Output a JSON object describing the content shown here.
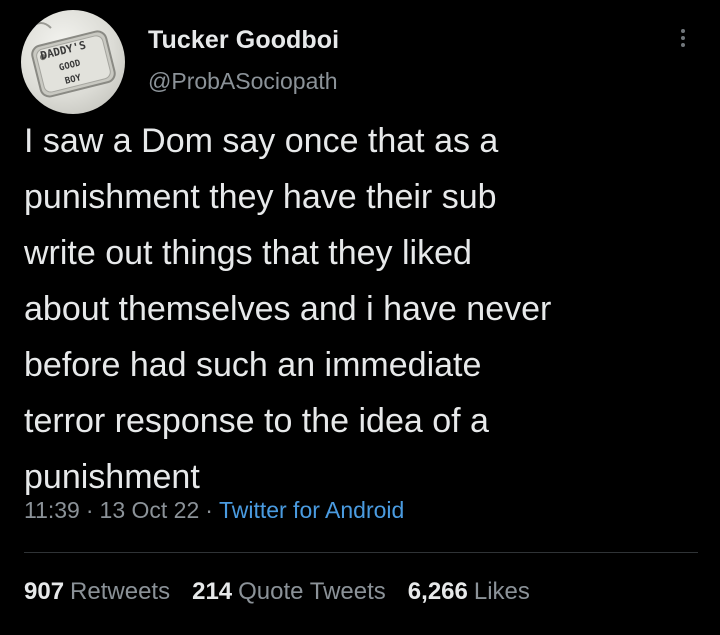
{
  "tweet": {
    "avatar": {
      "icon": "dog-tag-avatar",
      "tag_lines": [
        "DADDY'S",
        "GOOD",
        "BOY"
      ]
    },
    "display_name": "Tucker Goodboi",
    "handle": "@ProbASociopath",
    "more_icon": "more-options-icon",
    "body_lines": [
      "I saw a Dom say once that as a",
      "punishment they have their sub",
      "write out things that they liked",
      "about themselves and i have never",
      "before had such an immediate",
      "terror response to the idea of a",
      "punishment"
    ],
    "meta": {
      "time": "11:39",
      "date": "13 Oct 22",
      "separator": "·",
      "source": "Twitter for Android"
    },
    "stats": {
      "retweets_count": "907",
      "retweets_label": "Retweets",
      "quotes_count": "214",
      "quotes_label": "Quote Tweets",
      "likes_count": "6,266",
      "likes_label": "Likes"
    },
    "colors": {
      "background": "#000000",
      "text": "#e7e9ea",
      "secondary": "#8b9298",
      "link": "#4a9be0",
      "divider": "#2f3336"
    }
  }
}
